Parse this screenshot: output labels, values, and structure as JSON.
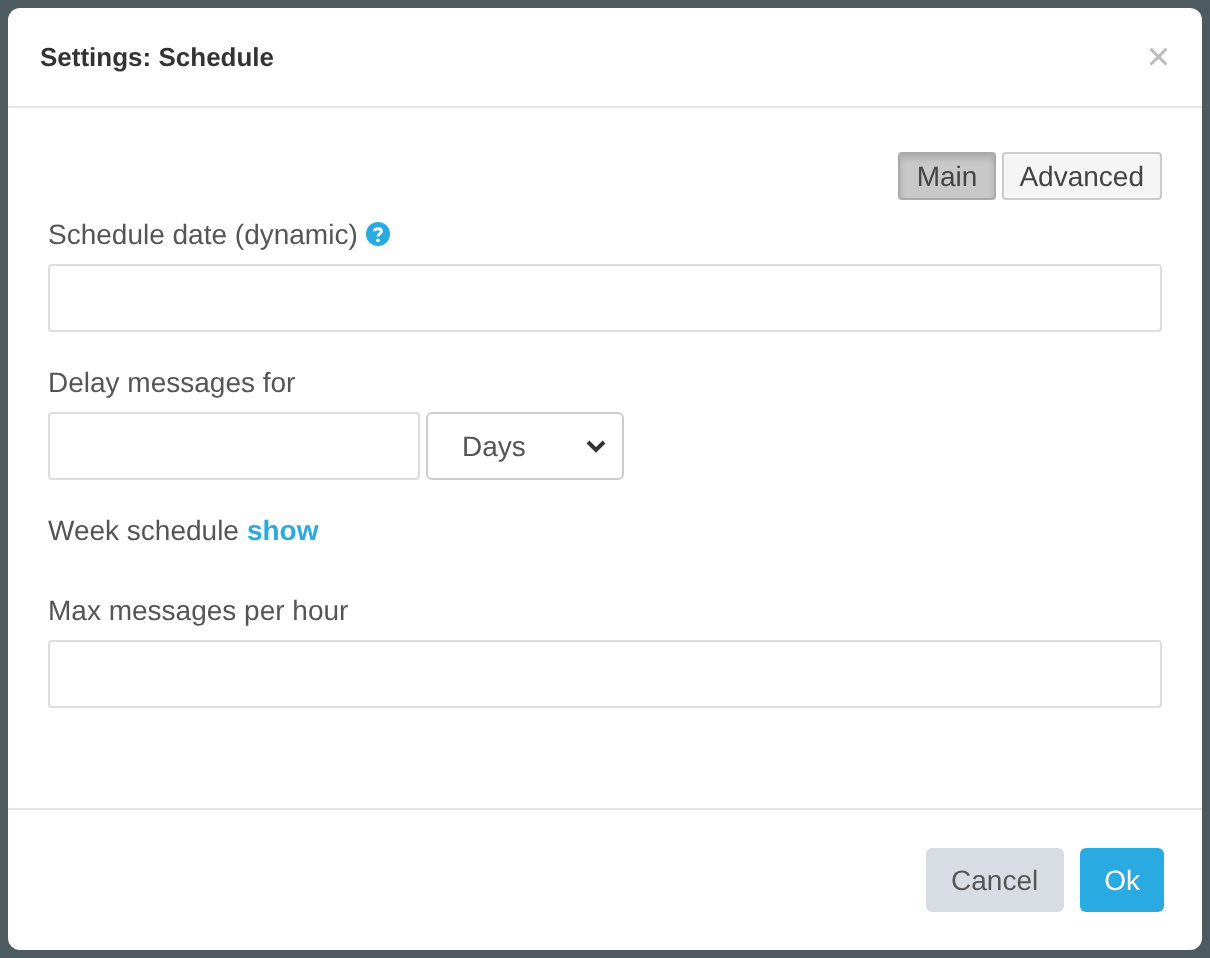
{
  "dialog": {
    "title": "Settings: Schedule",
    "close": "×"
  },
  "tabs": [
    {
      "label": "Main",
      "selected": true
    },
    {
      "label": "Advanced",
      "selected": false
    }
  ],
  "fields": [
    {
      "kind": "text",
      "label": "Schedule date (dynamic)",
      "has_help": true
    },
    {
      "kind": "duration",
      "label": "Delay messages for",
      "unit": "Days"
    },
    {
      "kind": "link",
      "label": "Week schedule",
      "link": "show"
    },
    {
      "kind": "text",
      "label": "Max messages per hour",
      "has_help": false
    }
  ],
  "buttons": [
    {
      "label": "Cancel",
      "kind": "secondary"
    },
    {
      "label": "Ok",
      "kind": "primary"
    }
  ]
}
